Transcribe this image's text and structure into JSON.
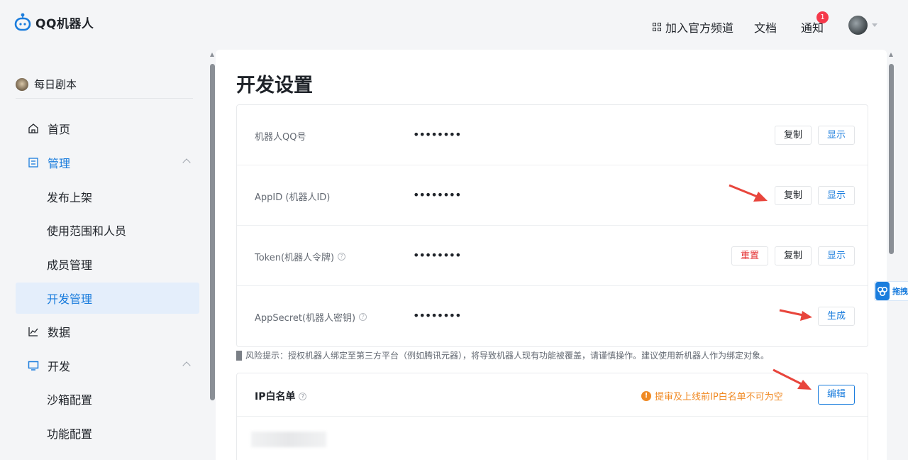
{
  "header": {
    "logo_text": "QQ机器人",
    "channel_link": "加入官方频道",
    "docs_link": "文档",
    "notify_link": "通知",
    "notify_count": "1"
  },
  "sidebar": {
    "bot_name": "每日剧本",
    "items": [
      {
        "label": "首页"
      },
      {
        "label": "管理"
      },
      {
        "label": "发布上架"
      },
      {
        "label": "使用范围和人员"
      },
      {
        "label": "成员管理"
      },
      {
        "label": "开发管理"
      },
      {
        "label": "数据"
      },
      {
        "label": "开发"
      },
      {
        "label": "沙箱配置"
      },
      {
        "label": "功能配置"
      }
    ]
  },
  "main": {
    "title": "开发设置",
    "rows": [
      {
        "label": "机器人QQ号",
        "value": "••••••••",
        "copy": "复制",
        "show": "显示"
      },
      {
        "label": "AppID (机器人ID)",
        "value": "••••••••",
        "copy": "复制",
        "show": "显示"
      },
      {
        "label": "Token(机器人令牌)",
        "value": "••••••••",
        "reset": "重置",
        "copy": "复制",
        "show": "显示"
      },
      {
        "label": "AppSecret(机器人密钥)",
        "value": "••••••••",
        "generate": "生成"
      }
    ],
    "risk_notice": "风险提示：授权机器人绑定至第三方平台（例如腾讯元器），将导致机器人现有功能被覆盖，请谨慎操作。建议使用新机器人作为绑定对象。",
    "ip_whitelist": {
      "title": "IP白名单",
      "warning": "提审及上线前IP白名单不可为空",
      "edit": "编辑"
    }
  },
  "float_tab": {
    "label": "拖拽"
  },
  "colors": {
    "accent": "#1b7ddd",
    "danger": "#e5393b",
    "warning": "#f08a24"
  }
}
